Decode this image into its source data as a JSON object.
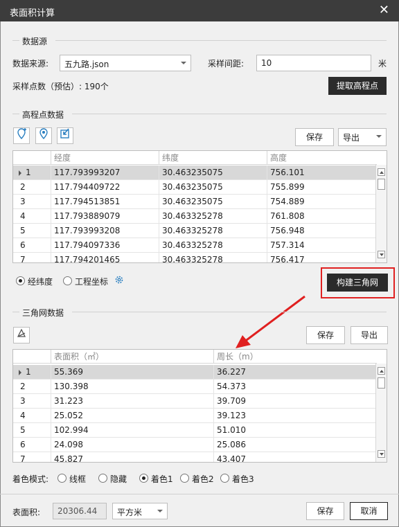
{
  "window": {
    "title": "表面积计算",
    "close_glyph": "✕"
  },
  "datasource": {
    "section_title": "数据源",
    "source_label": "数据来源:",
    "source_value": "五九路.json",
    "interval_label": "采样间距:",
    "interval_value": "10",
    "interval_unit": "米",
    "count_label": "采样点数（预估）: 190个",
    "extract_button": "提取高程点"
  },
  "elevation": {
    "section_title": "高程点数据",
    "toolbar_icons": [
      "add-point-icon",
      "location-icon",
      "import-icon"
    ],
    "save_button": "保存",
    "export_select": "导出",
    "columns": [
      "经度",
      "纬度",
      "高度"
    ],
    "rows": [
      {
        "idx": "1",
        "lon": "117.793993207",
        "lat": "30.463235075",
        "h": "756.101"
      },
      {
        "idx": "2",
        "lon": "117.794409722",
        "lat": "30.463235075",
        "h": "755.899"
      },
      {
        "idx": "3",
        "lon": "117.794513851",
        "lat": "30.463235075",
        "h": "754.889"
      },
      {
        "idx": "4",
        "lon": "117.793889079",
        "lat": "30.463325278",
        "h": "761.808"
      },
      {
        "idx": "5",
        "lon": "117.793993208",
        "lat": "30.463325278",
        "h": "756.948"
      },
      {
        "idx": "6",
        "lon": "117.794097336",
        "lat": "30.463325278",
        "h": "757.314"
      },
      {
        "idx": "7",
        "lon": "117.794201465",
        "lat": "30.463325278",
        "h": "756.417"
      }
    ],
    "coord_options": [
      "经纬度",
      "工程坐标"
    ],
    "selected_coord": "经纬度",
    "build_button": "构建三角网"
  },
  "triangle": {
    "section_title": "三角网数据",
    "save_button": "保存",
    "export_button": "导出",
    "columns": [
      "表面积（㎡）",
      "周长（m）"
    ],
    "rows": [
      {
        "idx": "1",
        "area": "55.369",
        "perim": "36.227"
      },
      {
        "idx": "2",
        "area": "130.398",
        "perim": "54.373"
      },
      {
        "idx": "3",
        "area": "31.223",
        "perim": "39.709"
      },
      {
        "idx": "4",
        "area": "25.052",
        "perim": "39.123"
      },
      {
        "idx": "5",
        "area": "102.994",
        "perim": "51.010"
      },
      {
        "idx": "6",
        "area": "24.098",
        "perim": "25.086"
      },
      {
        "idx": "7",
        "area": "45.827",
        "perim": "43.407"
      }
    ],
    "color_mode_label": "着色模式:",
    "color_options": [
      "线框",
      "隐藏",
      "着色1",
      "着色2",
      "着色3"
    ],
    "selected_color": "着色1"
  },
  "footer": {
    "area_label": "表面积:",
    "area_value": "20306.44",
    "unit_select": "平方米",
    "save_button": "保存",
    "cancel_button": "取消"
  },
  "colors": {
    "highlight": "#e02020",
    "titlebar": "#3c3c3c",
    "dark_button": "#2b2b2b"
  }
}
